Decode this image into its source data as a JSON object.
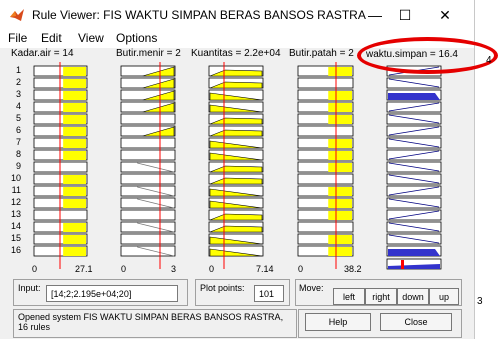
{
  "window": {
    "title": "Rule Viewer: FIS WAKTU SIMPAN BERAS BANSOS RASTRA",
    "minimize": "—",
    "maximize": "☐",
    "close": "✕"
  },
  "menu": [
    "File",
    "Edit",
    "View",
    "Options"
  ],
  "inputs": [
    {
      "label": "Kadar.air = 14",
      "min": "0",
      "max": "27.1"
    },
    {
      "label": "Butir.menir = 2",
      "min": "0",
      "max": "3"
    },
    {
      "label": "Kuantitas = 2.2e+04",
      "min": "0",
      "max": "7.14"
    },
    {
      "label": "Butir.patah = 2",
      "min": "0",
      "max": "38.2"
    }
  ],
  "output": {
    "label": "waktu.simpan = 16.4"
  },
  "rule_numbers": [
    "1",
    "2",
    "3",
    "4",
    "5",
    "6",
    "7",
    "8",
    "9",
    "10",
    "11",
    "12",
    "13",
    "14",
    "15",
    "16"
  ],
  "bottom": {
    "input_label": "Input:",
    "input_value": "[14;2;2.195e+04;20]",
    "plot_points_label": "Plot points:",
    "plot_points_value": "101",
    "move_label": "Move:",
    "move_buttons": [
      "left",
      "right",
      "down",
      "up"
    ],
    "status": "Opened system FIS WAKTU SIMPAN BERAS BANSOS RASTRA, 16 rules",
    "help": "Help",
    "close": "Close"
  },
  "edge_text": {
    "right_top": "4",
    "right_bottom": "3"
  },
  "colors": {
    "fill": "#ffff00",
    "output_fill": "#3333cc",
    "indicator": "#ff0000",
    "edge": "#000080"
  }
}
